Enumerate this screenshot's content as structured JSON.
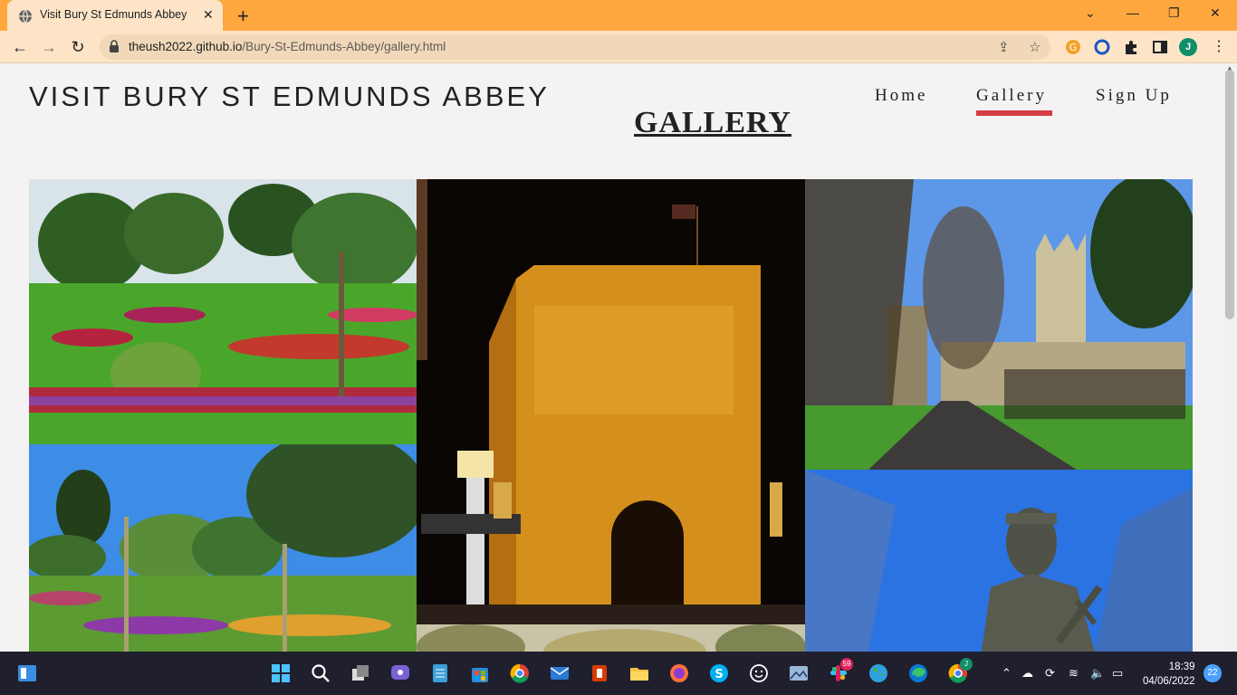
{
  "browser": {
    "tab_title": "Visit Bury St Edmunds Abbey",
    "close_tab": "✕",
    "new_tab": "+",
    "url_host": "theush2022.github.io",
    "url_path": "/Bury-St-Edmunds-Abbey/gallery.html",
    "profile_initial": "J",
    "accent_color": "#ffa73f"
  },
  "site": {
    "title": "VISIT BURY ST EDMUNDS ABBEY",
    "nav": [
      {
        "label": "Home"
      },
      {
        "label": "Gallery",
        "active": true
      },
      {
        "label": "Sign Up"
      }
    ],
    "heading": "GALLERY",
    "active_color": "#d63d45"
  },
  "gallery": {
    "photos": [
      {
        "name": "abbey-gardens-flowerbeds"
      },
      {
        "name": "abbey-gate-at-night"
      },
      {
        "name": "tree-lined-path-cathedral"
      },
      {
        "name": "abbey-gardens-park"
      },
      {
        "name": "st-edmund-statue"
      },
      {
        "name": "garden-trees-partial"
      }
    ]
  },
  "taskbar": {
    "time": "18:39",
    "date": "04/06/2022",
    "notification_count": "22",
    "slack_badge": "59",
    "teams_badge": "J"
  }
}
